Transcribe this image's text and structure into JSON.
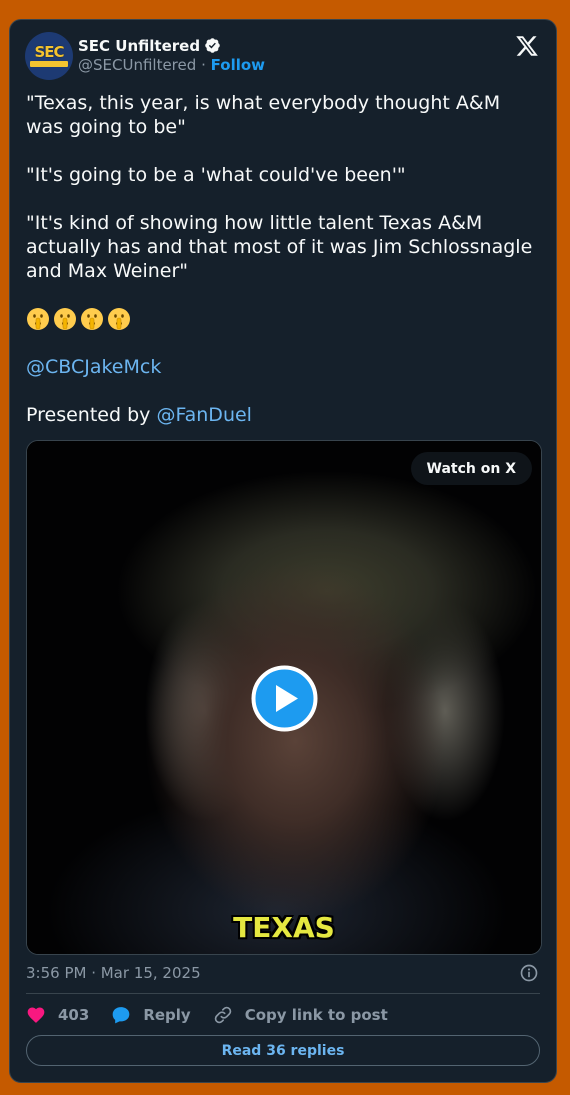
{
  "author": {
    "display_name": "SEC Unfiltered",
    "handle": "@SECUnfiltered",
    "separator": "·",
    "follow_label": "Follow",
    "avatar_logo_text": "SEC",
    "avatar_logo_subtext": "UNFILTERED"
  },
  "tweet": {
    "paragraphs": [
      "\"Texas, this year, is what everybody thought A&M was going to be\"",
      "\"It's going to be a 'what could've been'\"",
      "\"It's kind of showing how little talent Texas A&M actually has and that most of it was Jim Schlossnagle and Max Weiner\""
    ],
    "emoji_count": 4,
    "emoji_name": "shushing-face",
    "mention": "@CBCJakeMck",
    "presented_by_prefix": "Presented by",
    "presented_by_mention": "@FanDuel"
  },
  "media": {
    "watch_label": "Watch on X",
    "video_caption": "TEXAS"
  },
  "meta": {
    "timestamp": "3:56 PM · Mar 15, 2025"
  },
  "actions": {
    "like_count": "403",
    "reply_label": "Reply",
    "copy_link_label": "Copy link to post",
    "read_replies_label": "Read 36 replies"
  },
  "colors": {
    "page_background": "#c55a00",
    "card_background": "#15202b",
    "accent": "#1d9bf0",
    "link": "#6cb5f0",
    "like": "#f91880"
  }
}
